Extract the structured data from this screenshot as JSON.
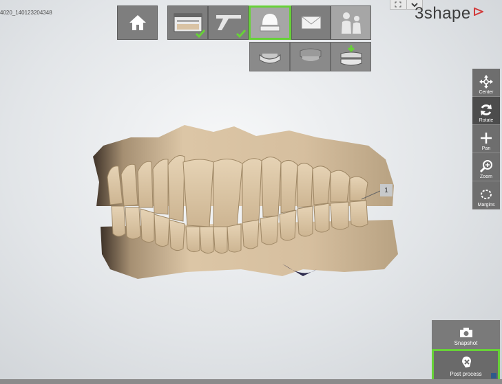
{
  "case_id": "4020_140123204348",
  "logo": {
    "text": "3shape"
  },
  "toolbar": {
    "buttons": [
      {
        "name": "home",
        "icon": "home-icon"
      },
      {
        "name": "order-form",
        "icon": "order-form-icon",
        "completed": true
      },
      {
        "name": "scanner",
        "icon": "scanner-icon",
        "completed": true
      },
      {
        "name": "scan",
        "icon": "impression-dome-icon",
        "active": true
      },
      {
        "name": "send",
        "icon": "envelope-icon"
      },
      {
        "name": "contacts",
        "icon": "people-icon"
      }
    ],
    "sub_buttons": [
      {
        "name": "lower-jaw-scan",
        "icon": "lower-jaw-icon"
      },
      {
        "name": "upper-jaw-scan",
        "icon": "upper-jaw-icon"
      },
      {
        "name": "bite-scan",
        "icon": "bite-icon"
      }
    ]
  },
  "view_tools": [
    {
      "label": "Center",
      "icon": "center-move-icon"
    },
    {
      "label": "Rotate",
      "icon": "rotate-icon",
      "active": true
    },
    {
      "label": "Pan",
      "icon": "pan-icon"
    },
    {
      "label": "Zoom",
      "icon": "zoom-icon"
    },
    {
      "label": "Margins",
      "icon": "margins-icon"
    }
  ],
  "actions": {
    "snapshot_label": "Snapshot",
    "post_process_label": "Post process"
  },
  "model": {
    "tooth_label": "1"
  },
  "colors": {
    "accent_green": "#67d138",
    "toolbar_gray": "#7e7e7e",
    "model_beige": "#d9c3a4"
  }
}
